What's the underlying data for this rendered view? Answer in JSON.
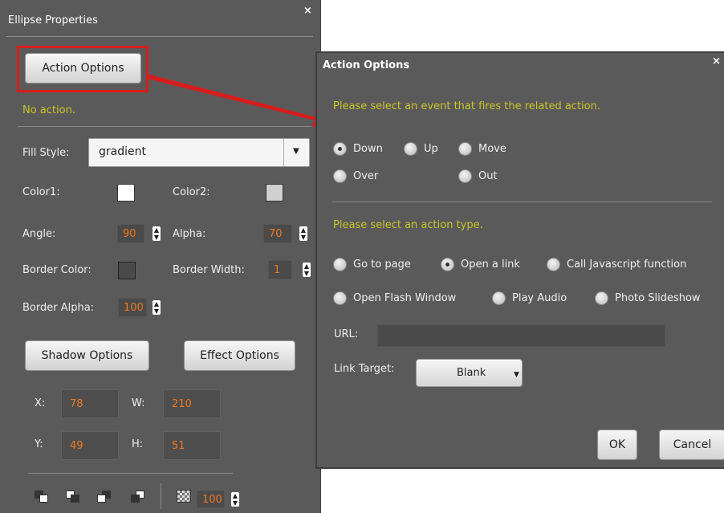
{
  "left_panel": {
    "title": "Ellipse Properties",
    "close": "×",
    "action_options_button": "Action Options",
    "status": "No action.",
    "fill_style": {
      "label": "Fill Style:",
      "value": "gradient"
    },
    "color1": {
      "label": "Color1:",
      "swatch": "#ffffff"
    },
    "color2": {
      "label": "Color2:",
      "swatch": "#d0d0d0"
    },
    "angle": {
      "label": "Angle:",
      "value": "90"
    },
    "alpha": {
      "label": "Alpha:",
      "value": "70"
    },
    "border_color": {
      "label": "Border Color:",
      "swatch": "#4a4a4a"
    },
    "border_width": {
      "label": "Border Width:",
      "value": "1"
    },
    "border_alpha": {
      "label": "Border Alpha:",
      "value": "100"
    },
    "shadow_options_button": "Shadow Options",
    "effect_options_button": "Effect Options",
    "coords": {
      "x_label": "X:",
      "x": "78",
      "w_label": "W:",
      "w": "210",
      "y_label": "Y:",
      "y": "49",
      "h_label": "H:",
      "h": "51"
    },
    "toolbar": {
      "icons": [
        "bring-to-front-icon",
        "send-to-back-icon",
        "bring-forward-icon",
        "send-backward-icon",
        "transparency-icon"
      ],
      "opacity": "100"
    }
  },
  "dialog": {
    "title": "Action Options",
    "close": "×",
    "event_hint": "Please select an event that fires the related action.",
    "events": [
      {
        "label": "Down",
        "selected": true
      },
      {
        "label": "Up",
        "selected": false
      },
      {
        "label": "Move",
        "selected": false
      },
      {
        "label": "Over",
        "selected": false
      },
      {
        "label": "Out",
        "selected": false
      }
    ],
    "action_hint": "Please select an action type.",
    "actions": [
      {
        "label": "Go to page",
        "selected": false
      },
      {
        "label": "Open a link",
        "selected": true
      },
      {
        "label": "Call Javascript function",
        "selected": false
      },
      {
        "label": "Open Flash Window",
        "selected": false
      },
      {
        "label": "Play Audio",
        "selected": false
      },
      {
        "label": "Photo Slideshow",
        "selected": false
      }
    ],
    "url": {
      "label": "URL:",
      "value": ""
    },
    "link_target": {
      "label": "Link Target:",
      "value": "Blank"
    },
    "ok_button": "OK",
    "cancel_button": "Cancel"
  },
  "colors": {
    "panel_bg": "#5a5a5a",
    "hint_yellow": "#c9c628",
    "value_orange": "#f07820",
    "highlight_red": "#d81e1e"
  }
}
